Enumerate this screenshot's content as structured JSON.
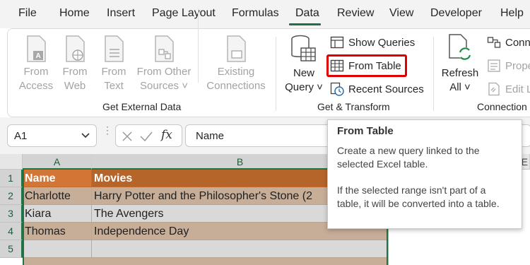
{
  "menu": {
    "tabs": [
      "File",
      "Home",
      "Insert",
      "Page Layout",
      "Formulas",
      "Data",
      "Review",
      "View",
      "Developer",
      "Help"
    ],
    "active_tab": "Data"
  },
  "ribbon": {
    "get_external_data": {
      "group_label": "Get External Data",
      "buttons": [
        {
          "line1": "From",
          "line2": "Access"
        },
        {
          "line1": "From",
          "line2": "Web"
        },
        {
          "line1": "From",
          "line2": "Text"
        },
        {
          "line1": "From Other",
          "line2": "Sources ˅"
        },
        {
          "line1": "Existing",
          "line2": "Connections"
        }
      ]
    },
    "get_transform": {
      "group_label": "Get & Transform",
      "new_query": {
        "line1": "New",
        "line2": "Query ˅"
      },
      "show_queries": "Show Queries",
      "from_table": "From Table",
      "recent_sources": "Recent Sources"
    },
    "connections": {
      "group_label": "Connection",
      "refresh_all": {
        "line1": "Refresh",
        "line2": "All ˅"
      },
      "connections": "Conn",
      "properties": "Prope",
      "edit_links": "Edit L"
    }
  },
  "formula_bar": {
    "name_box": "A1",
    "fx_label": "fx",
    "formula_value": "Name"
  },
  "grid": {
    "columns": [
      "A",
      "B",
      "E"
    ],
    "rows": [
      "1",
      "2",
      "3",
      "4",
      "5"
    ],
    "header": [
      "Name",
      "Movies"
    ],
    "data": [
      [
        "Charlotte",
        "Harry Potter and the Philosopher's Stone (2"
      ],
      [
        "Kiara",
        "The Avengers"
      ],
      [
        "Thomas",
        "Independence Day"
      ]
    ]
  },
  "tooltip": {
    "title": "From Table",
    "body1": "Create a new query linked to the selected Excel table.",
    "body2": "If the selected range isn't part of a table, it will be converted into a table."
  },
  "colors": {
    "excel_green": "#217346",
    "highlight_red": "#e00000",
    "header_orange": "#d27535",
    "body_tan": "#c6ae99"
  }
}
